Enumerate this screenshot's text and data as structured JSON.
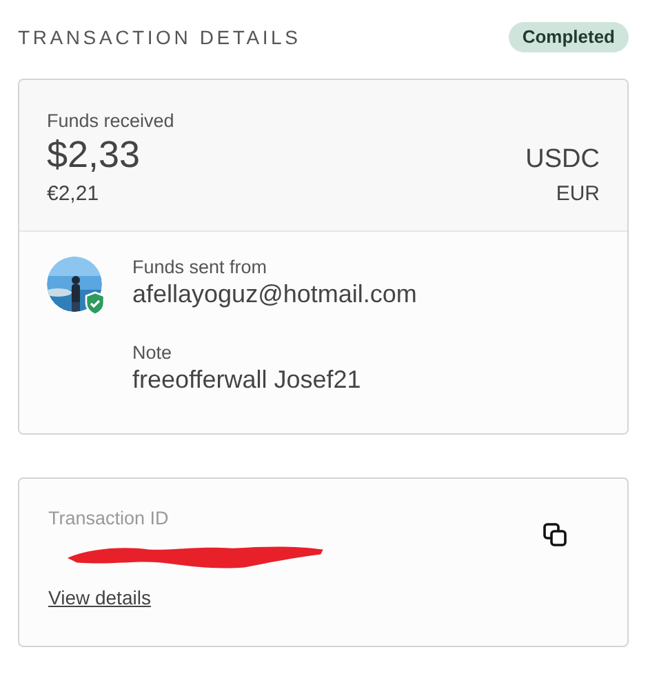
{
  "header": {
    "title": "TRANSACTION DETAILS",
    "status": "Completed"
  },
  "funds": {
    "label": "Funds received",
    "amount": "$2,33",
    "currency": "USDC",
    "converted": "€2,21",
    "converted_currency": "EUR"
  },
  "sender": {
    "label": "Funds sent from",
    "email": "afellayoguz@hotmail.com",
    "verified": true
  },
  "note": {
    "label": "Note",
    "text": "freeofferwall Josef21"
  },
  "transaction": {
    "label": "Transaction ID",
    "redacted": true,
    "link": "View details"
  }
}
